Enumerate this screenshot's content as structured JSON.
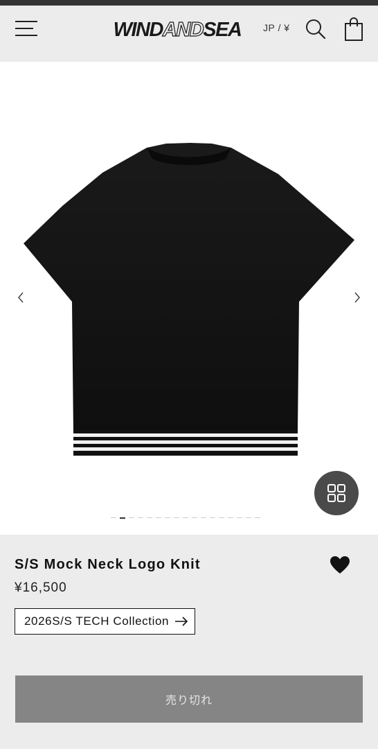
{
  "header": {
    "logo_left": "WIND",
    "logo_mid": "AND",
    "logo_right": "SEA",
    "currency": "JP / ¥",
    "icons": [
      "menu-icon",
      "search-icon",
      "shopping-bag-icon"
    ]
  },
  "gallery": {
    "image_alt_icon": "shirt-image",
    "page_count": 17,
    "active_index": 1,
    "icons": [
      "chevron-left-icon",
      "chevron-right-icon",
      "grid-icon"
    ]
  },
  "product": {
    "title": "S/S Mock Neck Logo Knit",
    "price": "¥16,500",
    "collection": "2026S/S TECH Collection",
    "favorite_icon": "heart-icon",
    "sold_out_label": "売り切れ"
  },
  "colors": {
    "header_bg": "#ececec",
    "top_bar": "#333333",
    "info_bg": "#ececec",
    "sold_out_bg": "#858585",
    "grid_button_bg": "#4a4a4a"
  }
}
